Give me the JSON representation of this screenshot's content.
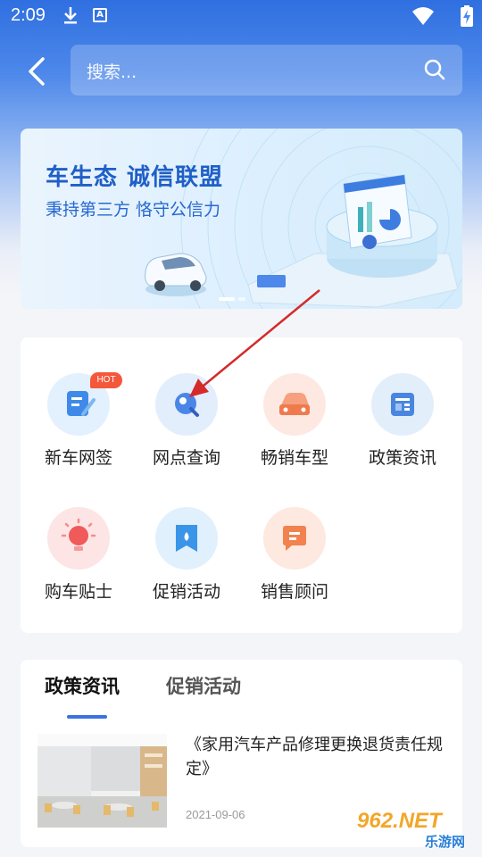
{
  "status_bar": {
    "time": "2:09",
    "a_icon": "A"
  },
  "header": {
    "search_placeholder": "搜索..."
  },
  "banner": {
    "title": "车生态  诚信联盟",
    "subtitle": "秉持第三方 恪守公信力"
  },
  "grid": {
    "items": [
      {
        "label": "新车网签",
        "icon": "contract-sign-icon",
        "badge": "HOT",
        "color": "#3f8ae8",
        "bg": "#e3f0fd"
      },
      {
        "label": "网点查询",
        "icon": "location-search-icon",
        "color": "#3f7fe6",
        "bg": "#e3eefc"
      },
      {
        "label": "畅销车型",
        "icon": "car-icon",
        "color": "#f07a4d",
        "bg": "#fde9e1"
      },
      {
        "label": "政策资讯",
        "icon": "news-icon",
        "color": "#4a86e0",
        "bg": "#e3eefb"
      },
      {
        "label": "购车贴士",
        "icon": "lightbulb-icon",
        "color": "#f05a5a",
        "bg": "#fde5e5"
      },
      {
        "label": "促销活动",
        "icon": "promo-tag-icon",
        "color": "#3a94e8",
        "bg": "#e0f0fc"
      },
      {
        "label": "销售顾问",
        "icon": "chat-bubble-icon",
        "color": "#f2824f",
        "bg": "#fde9df"
      }
    ]
  },
  "news": {
    "tabs": [
      {
        "label": "政策资讯",
        "active": true
      },
      {
        "label": "促销活动",
        "active": false
      }
    ],
    "items": [
      {
        "title": "《家用汽车产品修理更换退货责任规定》",
        "date": "2021-09-06"
      }
    ]
  },
  "watermark": {
    "number": "962.NET",
    "site": "乐游网"
  }
}
